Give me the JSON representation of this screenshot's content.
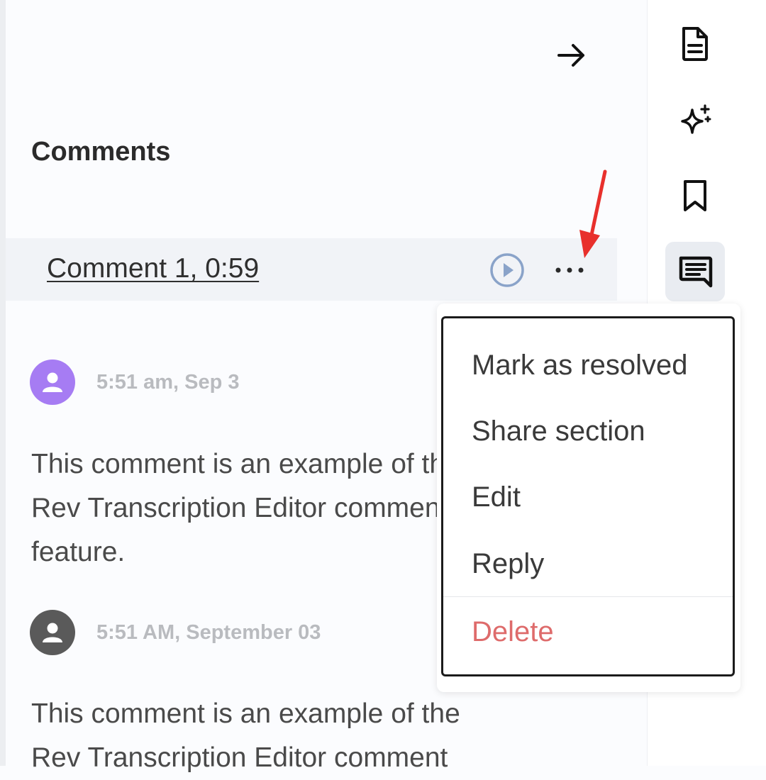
{
  "panel": {
    "title": "Comments",
    "collapse_icon": "arrow-right-icon"
  },
  "comment": {
    "link_label": "Comment 1, 0:59",
    "play_icon": "play-circle-icon",
    "more_icon": "more-horizontal-icon"
  },
  "entries": [
    {
      "avatar_color": "#a67cf3",
      "timestamp": "5:51 am, Sep 3",
      "lines": [
        "This comment is an example of the",
        "Rev Transcription Editor comment",
        "feature."
      ]
    },
    {
      "avatar_color": "#5a5a5a",
      "timestamp": "5:51 AM, September 03",
      "lines": [
        "This comment is an example of the",
        "Rev Transcription Editor comment"
      ]
    }
  ],
  "rail": {
    "items": [
      {
        "name": "document-icon",
        "active": false
      },
      {
        "name": "sparkle-icon",
        "active": false
      },
      {
        "name": "bookmark-icon",
        "active": false
      },
      {
        "name": "comment-icon",
        "active": true
      }
    ]
  },
  "menu": {
    "items": [
      "Mark as resolved",
      "Share section",
      "Edit",
      "Reply"
    ],
    "delete_label": "Delete",
    "delete_color": "#de6b6b"
  },
  "annotation": {
    "arrow_color": "#e8302c"
  }
}
